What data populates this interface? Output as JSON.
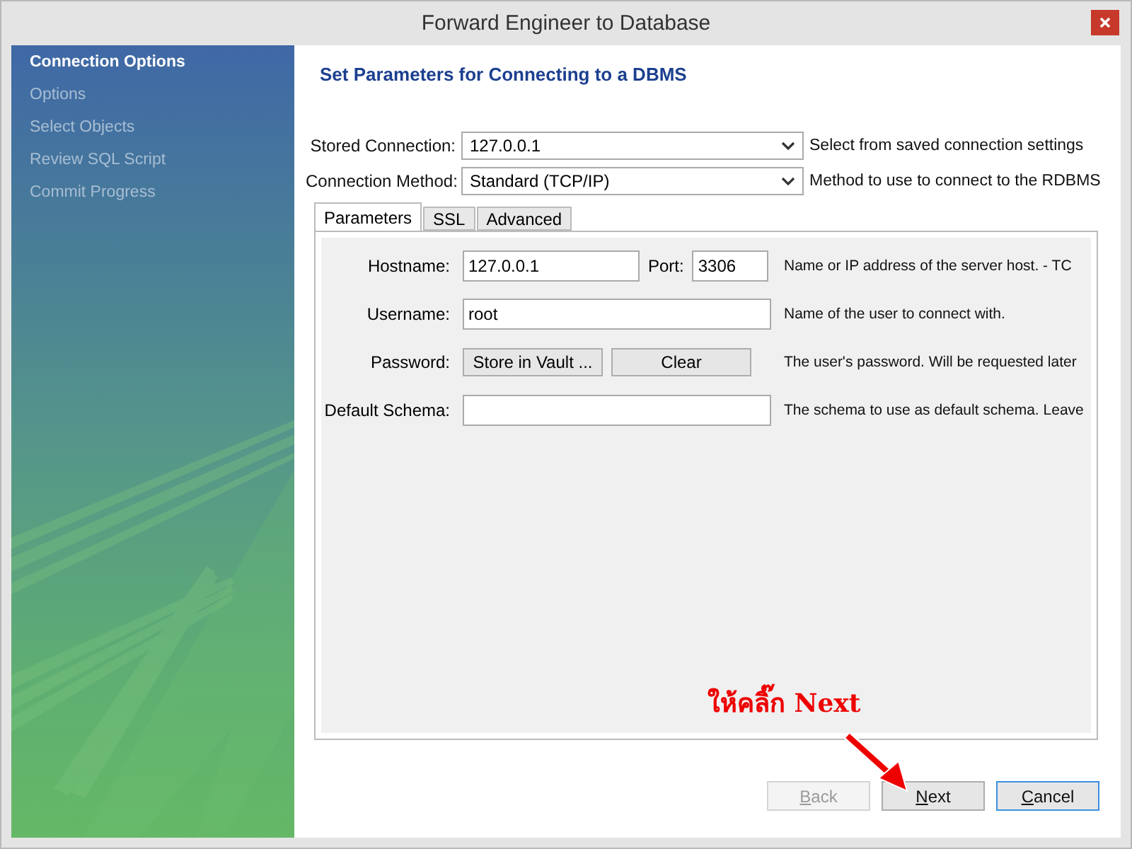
{
  "window": {
    "title": "Forward Engineer to Database"
  },
  "sidebar": {
    "items": [
      {
        "label": "Connection Options",
        "selected": true
      },
      {
        "label": "Options",
        "selected": false
      },
      {
        "label": "Select Objects",
        "selected": false
      },
      {
        "label": "Review SQL Script",
        "selected": false
      },
      {
        "label": "Commit Progress",
        "selected": false
      }
    ]
  },
  "heading": "Set Parameters for Connecting to a DBMS",
  "connection_fields": [
    {
      "label": "Stored Connection:",
      "value": "127.0.0.1",
      "description": "Select from saved connection settings"
    },
    {
      "label": "Connection Method:",
      "value": "Standard (TCP/IP)",
      "description": "Method to use to connect to the RDBMS"
    }
  ],
  "tabs": [
    {
      "label": "Parameters",
      "selected": true
    },
    {
      "label": "SSL",
      "selected": false
    },
    {
      "label": "Advanced",
      "selected": false
    }
  ],
  "parameters": [
    {
      "kind": "host",
      "label": "Hostname:",
      "value": "127.0.0.1",
      "port_label": "Port:",
      "port_value": "3306",
      "description": "Name or IP address of the server host. - TC"
    },
    {
      "kind": "text",
      "label": "Username:",
      "value": "root",
      "description": "Name of the user to connect with."
    },
    {
      "kind": "buttons",
      "label": "Password:",
      "buttons": [
        "Store in Vault ...",
        "Clear"
      ],
      "description": "The user's password. Will be requested later"
    },
    {
      "kind": "text",
      "label": "Default Schema:",
      "description": "The schema to use as default schema. Leave"
    }
  ],
  "annotation": {
    "text": "ให้คลิ๊ก Next"
  },
  "buttons": [
    {
      "label": "Back",
      "disabled": true,
      "default": false
    },
    {
      "label": "Next",
      "disabled": false,
      "default": false
    },
    {
      "label": "Cancel",
      "disabled": false,
      "default": true
    }
  ]
}
